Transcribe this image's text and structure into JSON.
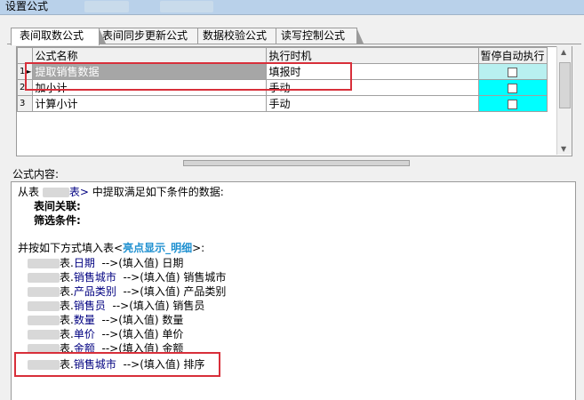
{
  "window": {
    "title": "设置公式"
  },
  "tabs": [
    {
      "label": "表间取数公式"
    },
    {
      "label": "表间同步更新公式"
    },
    {
      "label": "数据校验公式"
    },
    {
      "label": "读写控制公式"
    }
  ],
  "grid": {
    "headers": {
      "name": "公式名称",
      "timing": "执行时机",
      "pause": "暂停自动执行"
    },
    "rows": [
      {
        "num": "1",
        "name": "提取销售数据",
        "timing": "填报时",
        "pause_checked": false
      },
      {
        "num": "2",
        "name": "加小计",
        "timing": "手动",
        "pause_checked": false
      },
      {
        "num": "3",
        "name": "计算小计",
        "timing": "手动",
        "pause_checked": false
      }
    ]
  },
  "formula": {
    "label": "公式内容:",
    "source_prefix": "从表",
    "source_table_partial": "表>",
    "source_suffix": " 中提取满足如下条件的数据:",
    "join_label": "表间关联:",
    "filter_label": "筛选条件:",
    "fill_prefix": "并按如下方式填入表<",
    "target_table": "亮点显示_明细",
    "fill_suffix": ">:",
    "arrow_text": "-->(填入值)",
    "mappings": [
      {
        "src_prefix": "表.",
        "source": "日期",
        "target": "日期"
      },
      {
        "src_prefix": "表.",
        "source": "销售城市",
        "target": "销售城市"
      },
      {
        "src_prefix": "表.",
        "source": "产品类别",
        "target": "产品类别"
      },
      {
        "src_prefix": "表.",
        "source": "销售员",
        "target": "销售员"
      },
      {
        "src_prefix": "表.",
        "source": "数量",
        "target": "数量"
      },
      {
        "src_prefix": "表.",
        "source": "单价",
        "target": "单价"
      },
      {
        "src_prefix": "表.",
        "source": "金额",
        "target": "金额"
      },
      {
        "src_prefix": "表.",
        "source": "销售城市",
        "target": "排序"
      }
    ]
  },
  "colors": {
    "highlight_box": "#d82f3a",
    "cyan_cell": "#00ffff",
    "selected_cell": "#a6a6a6"
  }
}
